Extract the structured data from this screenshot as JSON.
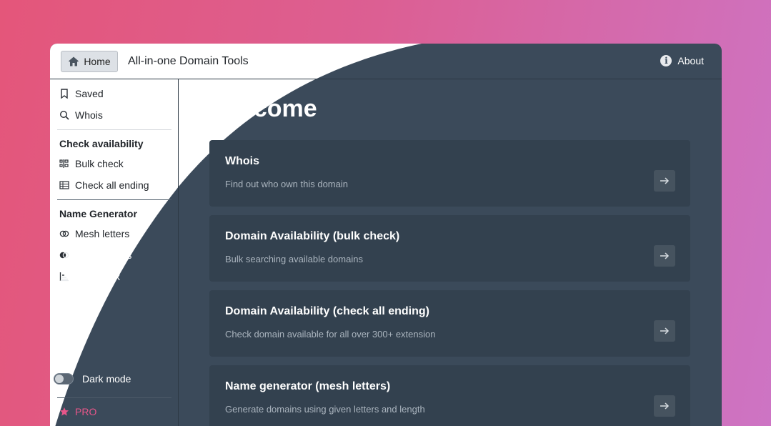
{
  "header": {
    "home_label": "Home",
    "app_title": "All-in-one Domain Tools",
    "about_label": "About"
  },
  "sidebar": {
    "saved_label": "Saved",
    "whois_label": "Whois",
    "section_check": "Check availability",
    "bulk_check_label": "Bulk check",
    "check_all_label": "Check all ending",
    "section_generator": "Name Generator",
    "mesh_label": "Mesh letters",
    "match_label": "Match words",
    "prefix_label": "Use prefix",
    "dark_mode_label": "Dark mode",
    "pro_label": "PRO"
  },
  "main": {
    "heading": "Welcome",
    "cards": [
      {
        "title": "Whois",
        "desc": "Find out who own this domain"
      },
      {
        "title": "Domain Availability (bulk check)",
        "desc": "Bulk searching available domains"
      },
      {
        "title": "Domain Availability (check all ending)",
        "desc": "Check domain available for all over 300+ extension"
      },
      {
        "title": "Name generator (mesh letters)",
        "desc": "Generate domains using given letters and length"
      }
    ]
  },
  "colors": {
    "dark_bg": "#3b4a5a",
    "card_bg": "#33414f",
    "accent_pro": "#e8568a"
  }
}
